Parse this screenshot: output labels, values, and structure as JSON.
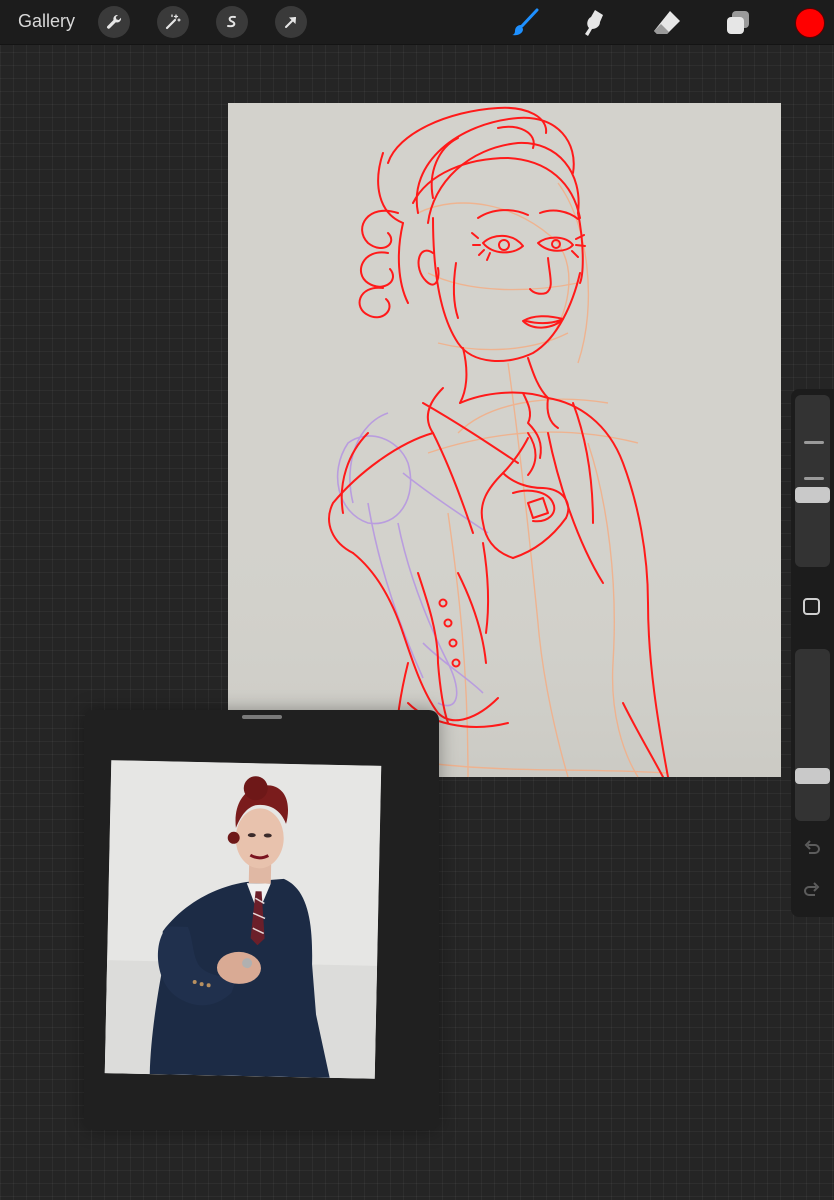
{
  "toolbar": {
    "gallery_label": "Gallery",
    "left_tools": [
      "wrench-icon",
      "magic-wand-icon",
      "selection-s-icon",
      "transform-arrow-icon"
    ],
    "right_tools": [
      "brush-icon",
      "smudge-icon",
      "eraser-icon",
      "layers-icon"
    ],
    "active_tool": "brush-icon",
    "active_tool_color": "#1e90ff",
    "current_color": "#ff0000"
  },
  "canvas": {
    "background_color": "#d3d2cc",
    "sketch_colors": [
      "#ff1a1a",
      "#b89be0",
      "#f2b08a"
    ]
  },
  "sidebar": {
    "brush_size_level": 0.2,
    "opacity_level": 0.8,
    "tools": [
      "modify-square-icon",
      "undo-icon",
      "redo-icon"
    ]
  },
  "reference": {
    "content": "photo"
  }
}
